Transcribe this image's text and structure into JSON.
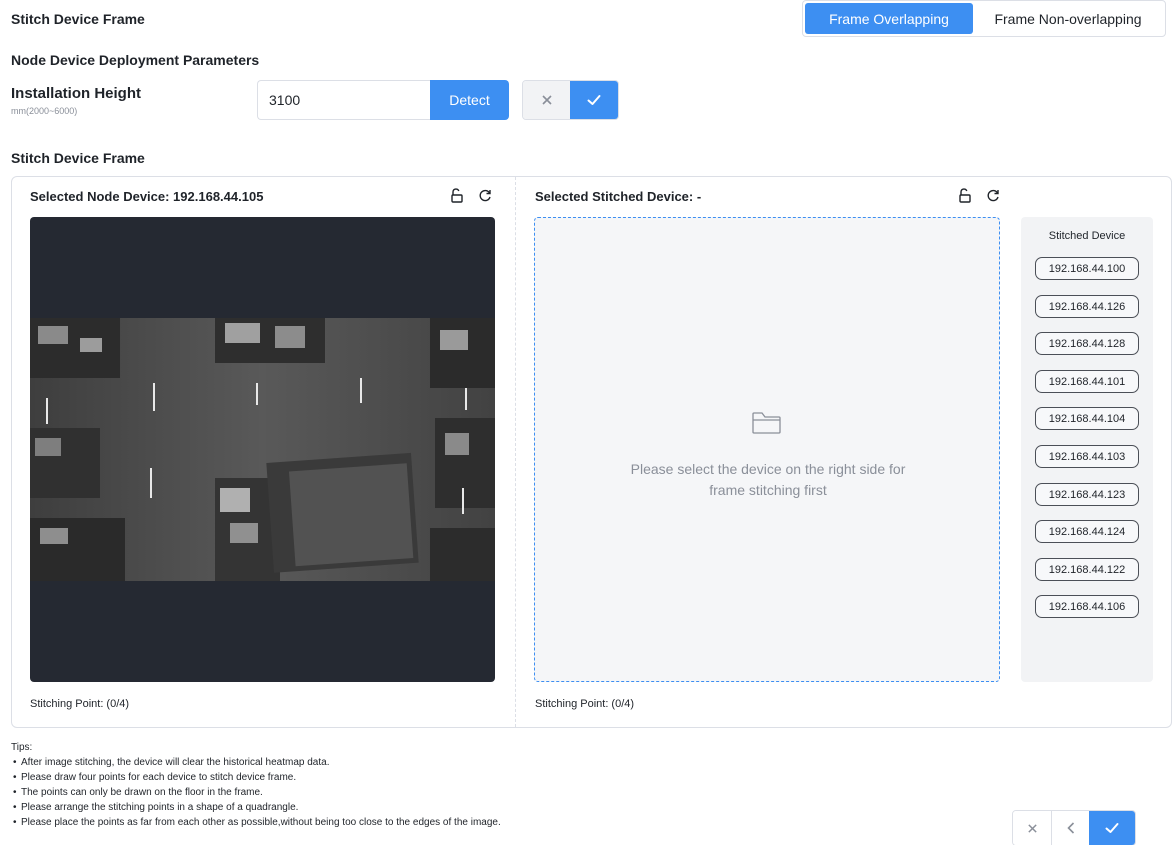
{
  "header": {
    "title": "Stitch Device Frame",
    "modes": [
      "Frame Overlapping",
      "Frame Non-overlapping"
    ],
    "active_mode": "Frame Overlapping"
  },
  "deployment": {
    "title": "Node Device Deployment Parameters",
    "height_label": "Installation Height",
    "height_range": "mm(2000~6000)",
    "height_value": "3100",
    "detect_label": "Detect"
  },
  "frame_section": {
    "title": "Stitch Device Frame",
    "node_panel": {
      "heading": "Selected Node Device: 192.168.44.105",
      "stitching_point": "Stitching Point: (0/4)"
    },
    "stitched_panel": {
      "heading": "Selected Stitched Device: -",
      "empty_line1": "Please select the device on the right side for",
      "empty_line2": "frame stitching first",
      "stitching_point": "Stitching Point: (0/4)"
    },
    "device_list": {
      "title": "Stitched Device",
      "devices": [
        "192.168.44.100",
        "192.168.44.126",
        "192.168.44.128",
        "192.168.44.101",
        "192.168.44.104",
        "192.168.44.103",
        "192.168.44.123",
        "192.168.44.124",
        "192.168.44.122",
        "192.168.44.106"
      ]
    }
  },
  "tips": {
    "title": "Tips:",
    "items": [
      "After image stitching, the device will clear the historical heatmap data.",
      "Please draw four points for each device to stitch device frame.",
      "The points can only be drawn on the floor in the frame.",
      "Please arrange the stitching points in a shape of a quadrangle.",
      "Please place the points as far from each other as possible,without being too close to the edges of the image."
    ]
  },
  "colors": {
    "accent": "#3d8ff2",
    "camera_bg": "#252932"
  }
}
